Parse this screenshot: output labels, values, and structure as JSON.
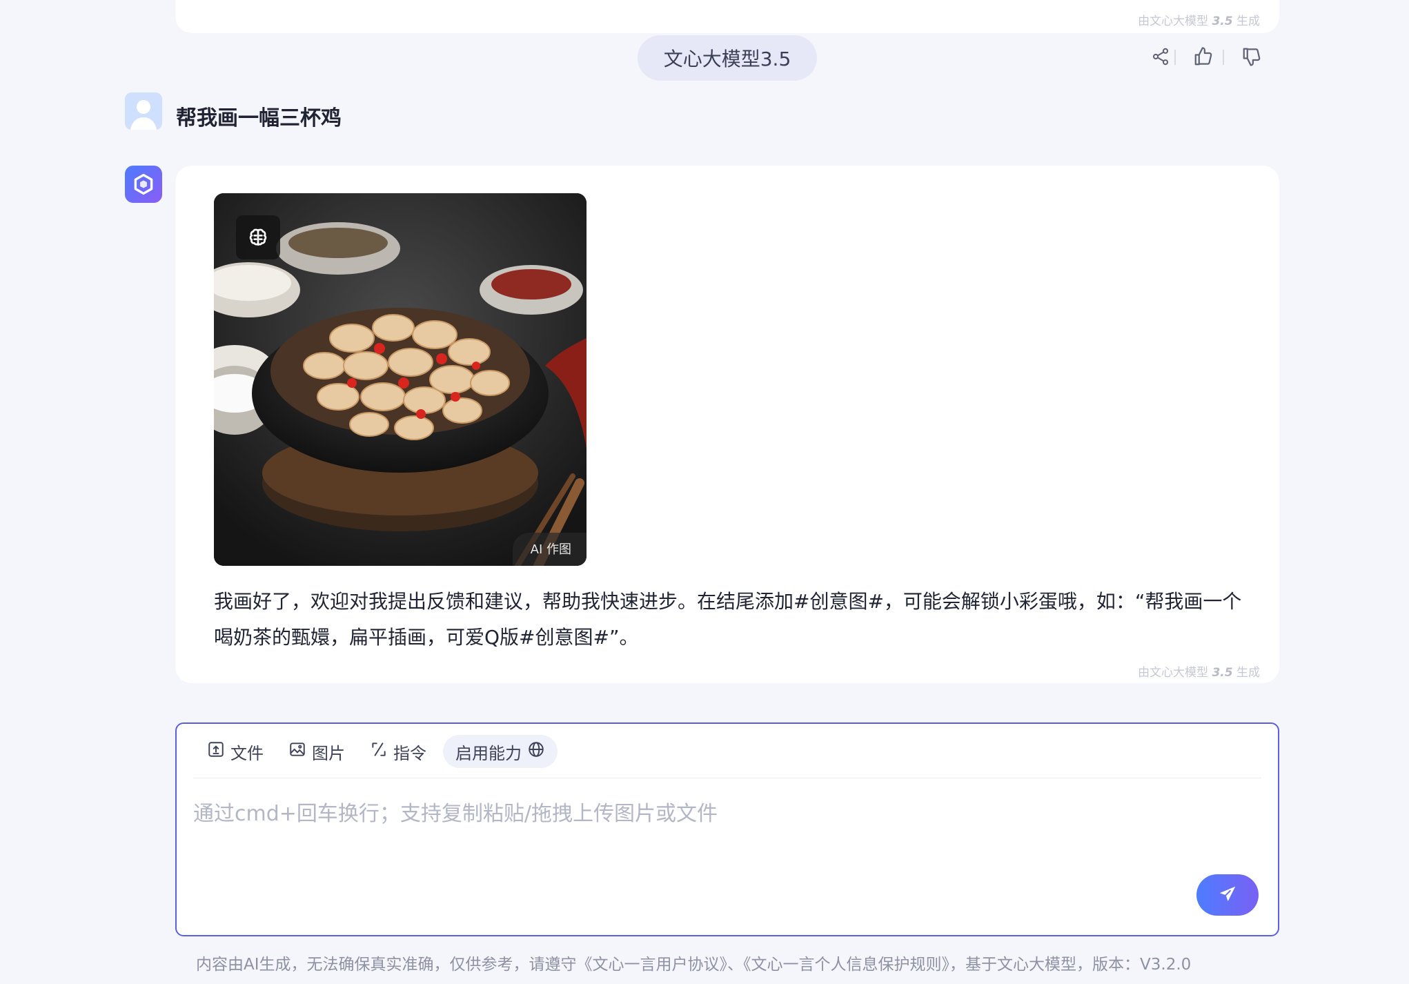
{
  "previous_message": {
    "generated_prefix": "由文心大模型",
    "generated_version": "3.5",
    "generated_suffix": "生成"
  },
  "model_pill": {
    "label": "文心大模型3.5"
  },
  "actions": {
    "share_icon": "share-icon",
    "like_icon": "thumbs-up-icon",
    "dislike_icon": "thumbs-down-icon"
  },
  "user_message": {
    "text": "帮我画一幅三杯鸡",
    "avatar_icon": "user-avatar-icon"
  },
  "bot_message": {
    "avatar_icon": "ernie-logo-icon",
    "image_badge_icon": "brain-icon",
    "image_tag": "AI 作图",
    "reply": "我画好了，欢迎对我提出反馈和建议，帮助我快速进步。在结尾添加#创意图#，可能会解锁小彩蛋哦，如：“帮我画一个喝奶茶的甄嬛，扁平插画，可爱Q版#创意图#”。",
    "generated_prefix": "由文心大模型",
    "generated_version": "3.5",
    "generated_suffix": "生成"
  },
  "composer": {
    "tools": [
      {
        "label": "文件",
        "icon": "upload-file-icon"
      },
      {
        "label": "图片",
        "icon": "image-icon"
      },
      {
        "label": "指令",
        "icon": "command-slash-icon"
      },
      {
        "label": "启用能力",
        "icon": "globe-icon"
      }
    ],
    "placeholder": "通过cmd+回车换行；支持复制粘贴/拖拽上传图片或文件",
    "value": "",
    "send_icon": "send-plane-icon"
  },
  "footer": {
    "text": "内容由AI生成，无法确保真实准确，仅供参考，请遵守《文心一言用户协议》、《文心一言个人信息保护规则》，基于文心大模型，版本：V3.2.0"
  },
  "colors": {
    "accent": "#5b5ee0",
    "send_gradient_start": "#4e7dff",
    "send_gradient_end": "#7a60f3",
    "page_bg": "#f5f6fb"
  }
}
